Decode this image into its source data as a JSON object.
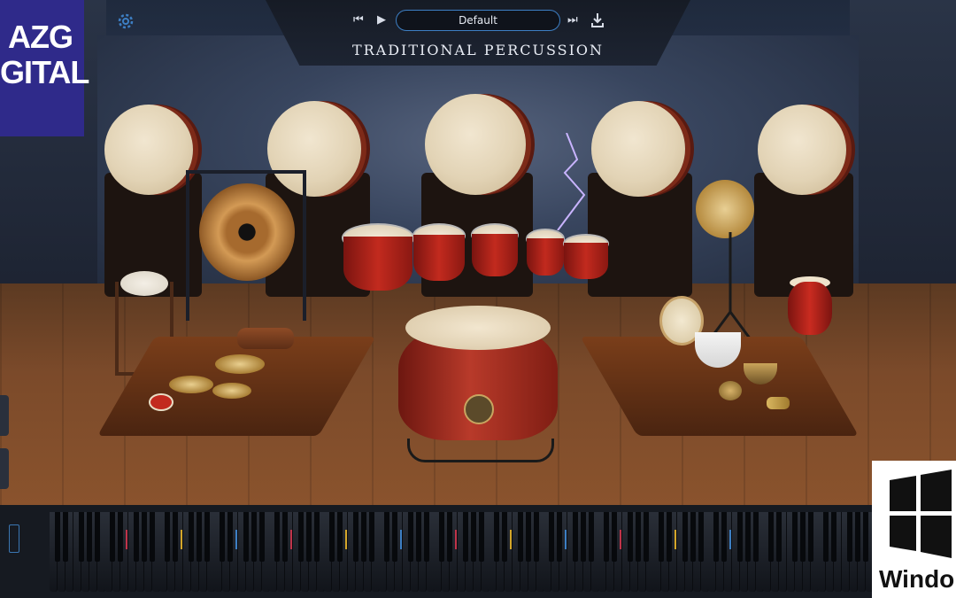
{
  "header": {
    "preset_name": "Default",
    "product_title": "TRADITIONAL PERCUSSION",
    "prev_preset_icon": "skip-back-icon",
    "play_icon": "play-icon",
    "next_preset_icon": "skip-forward-icon",
    "save_icon": "download-icon",
    "settings_icon": "gear-icon"
  },
  "overlays": {
    "brand_logo_text": "AZG DIGITAL",
    "os_badge_text": "Windo"
  },
  "colors": {
    "accent": "#3d7fc4",
    "drum_red": "#c22a1e",
    "drum_head": "#f2e6cf",
    "brand_badge": "#2f2a8a"
  },
  "keyboard": {
    "octave_count": 15
  }
}
